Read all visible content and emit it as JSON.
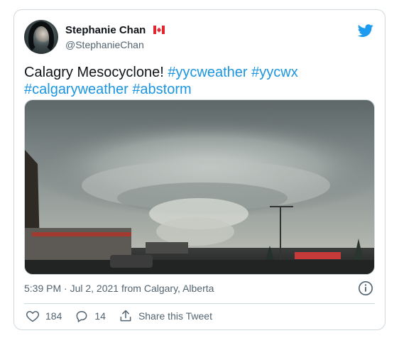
{
  "author": {
    "name": "Stephanie Chan",
    "handle": "@StephanieChan"
  },
  "tweet": {
    "text_plain": "Calagry Mesocyclone! ",
    "hashtags": [
      "#yycweather",
      "#yycwx",
      "#calgaryweather",
      "#abstorm"
    ],
    "timestamp": "5:39 PM · Jul 2, 2021 from Calgary, Alberta"
  },
  "actions": {
    "likes": "184",
    "replies": "14",
    "share_label": "Share this Tweet"
  },
  "icons": {
    "twitter": "twitter-bird-icon",
    "info": "info-icon",
    "like": "heart-icon",
    "reply": "reply-icon",
    "share": "share-icon",
    "flag": "canada-flag-icon"
  },
  "colors": {
    "accent": "#1b95e0",
    "muted": "#536471",
    "border": "#cfd9de"
  }
}
